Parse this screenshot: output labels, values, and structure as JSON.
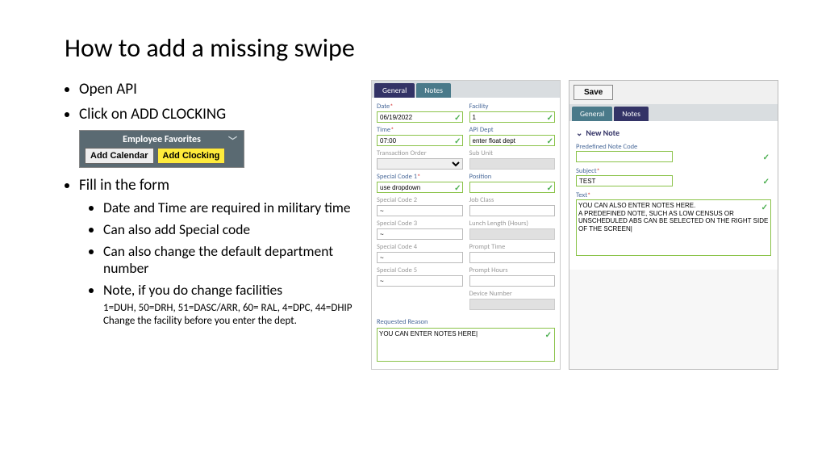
{
  "title": "How to add a missing swipe",
  "b1": "Open API",
  "b2": "Click on ADD CLOCKING",
  "b3": "Fill in the form",
  "sub1": "Date and Time are required in military time",
  "sub2": "Can also add Special code",
  "sub3": "Can also change the default department number",
  "sub4": "Note, if you do change facilities",
  "sub4_detail": "1=DUH, 50=DRH, 51=DASC/ARR, 60= RAL, 4=DPC, 44=DHIP  Change the facility  before you enter the dept.",
  "fav": {
    "title": "Employee Favorites",
    "cal": "Add Calendar",
    "clk": "Add Clocking"
  },
  "form": {
    "tab_general": "General",
    "tab_notes": "Notes",
    "date_lbl": "Date",
    "date_val": "06/19/2022",
    "time_lbl": "Time",
    "time_val": "07:00",
    "trans_lbl": "Transaction Order",
    "sc1_lbl": "Special Code 1",
    "sc1_val": "use dropdown",
    "sc2_lbl": "Special Code 2",
    "tilde": "~",
    "sc3_lbl": "Special Code 3",
    "sc4_lbl": "Special Code 4",
    "sc5_lbl": "Special Code 5",
    "fac_lbl": "Facility",
    "fac_val": "1",
    "dept_lbl": "API Dept",
    "dept_val": "enter float dept",
    "sub_lbl": "Sub Unit",
    "pos_lbl": "Position",
    "job_lbl": "Job Class",
    "lunch_lbl": "Lunch Length (Hours)",
    "prompt_t_lbl": "Prompt Time",
    "prompt_h_lbl": "Prompt Hours",
    "device_lbl": "Device Number",
    "reason_lbl": "Requested Reason",
    "reason_val": "YOU CAN ENTER NOTES HERE|"
  },
  "note": {
    "save": "Save",
    "tab_general": "General",
    "tab_notes": "Notes",
    "new_note": "New Note",
    "code_lbl": "Predefined Note Code",
    "subj_lbl": "Subject",
    "subj_val": "TEST",
    "text_lbl": "Text",
    "text_val": "YOU CAN ALSO ENTER NOTES HERE.\nA PREDEFINED NOTE, SUCH AS LOW CENSUS OR UNSCHEDULED ABS CAN BE SELECTED ON THE RIGHT SIDE OF THE SCREEN|"
  }
}
